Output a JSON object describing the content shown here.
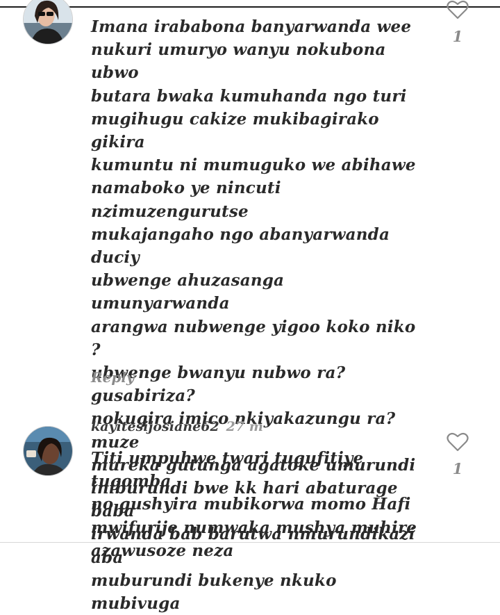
{
  "comments": [
    {
      "username": "",
      "time": "",
      "text": "Imana irababona banyarwanda wee\nnukuri umuryo wanyu nokubona ubwo\nbutara bwaka kumuhanda ngo turi\nmugihugu cakize mukibagirako gikira\nkumuntu ni mumuguko we abihawe\nnamaboko ye nincuti nzimuzengurutse\nmukajangaho ngo abanyarwanda duciy\nubwenge ahuzasanga umunyarwanda\narangwa nubwenge yigoo koko niko ?\nubwenge bwanyu nubwo ra?gusabiriza?\nnokugira imico nkiyakazungu ra?muze\nmureka gutunga agatoke umurundi\niniburundi bwe kk hari abaturage baba\nirwanda bab barutwa nmurundikazi aba\nmuburundi bukenye nkuko mubivuga",
      "reply_label": "Reply",
      "like_count": "1",
      "like_icon": "heart-outline-icon"
    },
    {
      "username": "kayitesijosiane62",
      "time": "27 m",
      "text": "Titi umpuhwe twari tugufitiye tugomba\nno gushyira mubikorwa  momo Hafi\nmwifurije numwaka mushya muhire\nazawusoze neza",
      "like_count": "1",
      "like_icon": "heart-outline-icon"
    }
  ]
}
